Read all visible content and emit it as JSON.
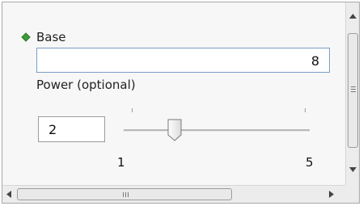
{
  "form": {
    "base_label": "Base",
    "base_value": "8",
    "power_label": "Power (optional)",
    "power_value": "2"
  },
  "slider": {
    "min_label": "1",
    "max_label": "5",
    "value": 2,
    "min": 1,
    "max": 5
  },
  "colors": {
    "required_indicator": "#3c9a3c",
    "input_border_focused": "#7a9cc6"
  },
  "icons": {
    "required": "green-diamond-icon",
    "scroll_up": "arrow-up-icon",
    "scroll_down": "arrow-down-icon",
    "scroll_left": "arrow-left-icon",
    "scroll_right": "arrow-right-icon"
  }
}
